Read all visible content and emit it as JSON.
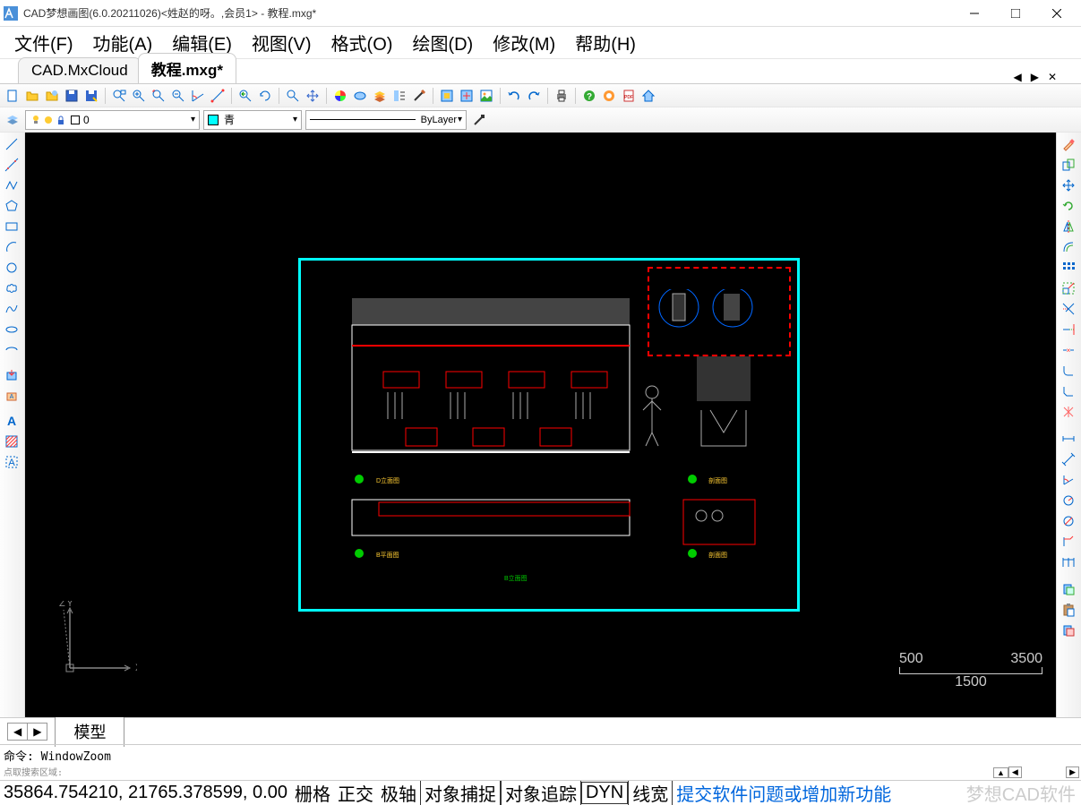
{
  "title": "CAD梦想画图(6.0.20211026)<姓赵的呀。,会员1> - 教程.mxg*",
  "menu": {
    "file": "文件(F)",
    "function": "功能(A)",
    "edit": "编辑(E)",
    "view": "视图(V)",
    "format": "格式(O)",
    "draw": "绘图(D)",
    "modify": "修改(M)",
    "help": "帮助(H)"
  },
  "tabs": {
    "tab1": "CAD.MxCloud",
    "tab2": "教程.mxg*"
  },
  "layer": {
    "current_name": "0",
    "color_label": "青",
    "linetype_label": "ByLayer"
  },
  "model_tab": "模型",
  "command": {
    "line1": "命令: WindowZoom",
    "line2": "点取搜索区域:"
  },
  "status": {
    "coords": "35864.754210, 21765.378599, 0.00",
    "grid": "栅格",
    "ortho": "正交",
    "polar": "极轴",
    "osnap": "对象捕捉",
    "otrack": "对象追踪",
    "dyn": "DYN",
    "lwt": "线宽",
    "link": "提交软件问题或增加新功能",
    "watermark": "梦想CAD软件"
  },
  "scale": {
    "left": "500",
    "right": "3500",
    "total": "1500"
  },
  "ucs": {
    "x": "X",
    "y": "Y",
    "z": "Z"
  },
  "drawing_labels": {
    "title_center": "B立面图",
    "elev_label": "D立面图",
    "plan_label": "B平面图",
    "section_label1": "剖面图",
    "section_label2": "剖面图"
  }
}
